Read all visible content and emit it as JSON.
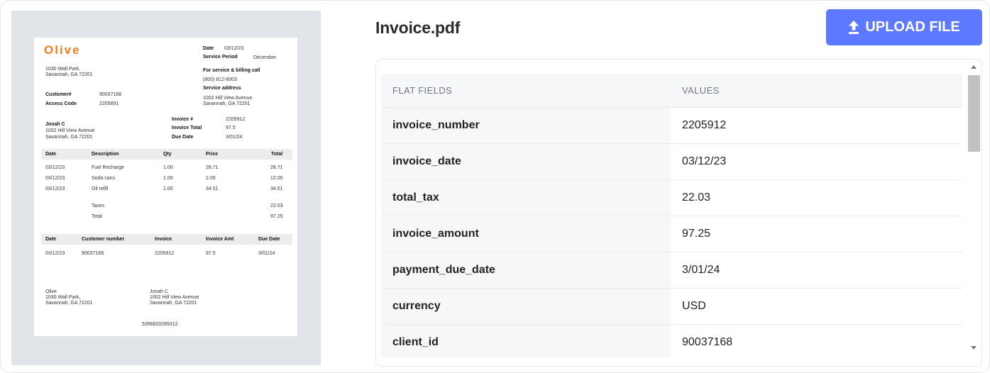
{
  "file": {
    "name": "Invoice.pdf"
  },
  "upload_button": {
    "label": "UPLOAD FILE",
    "icon": "upload-arrow-icon"
  },
  "colors": {
    "accent": "#5c79ff",
    "logo": "#ee7d1d"
  },
  "table": {
    "headers": [
      "FLAT FIELDS",
      "VALUES"
    ],
    "rows": [
      {
        "field": "invoice_number",
        "value": "2205912"
      },
      {
        "field": "invoice_date",
        "value": "03/12/23"
      },
      {
        "field": "total_tax",
        "value": "22.03"
      },
      {
        "field": "invoice_amount",
        "value": "97.25"
      },
      {
        "field": "payment_due_date",
        "value": "3/01/24"
      },
      {
        "field": "currency",
        "value": "USD"
      },
      {
        "field": "client_id",
        "value": "90037168"
      }
    ]
  },
  "doc": {
    "logo": "Olive",
    "sender_address": [
      "1030 Wall Park,",
      "Savannah, GA 72201"
    ],
    "date_label": "Date",
    "date_value": "03/12/23",
    "service_period_label": "Service Period",
    "service_period_value": "December",
    "billing_label": "For service & billing call",
    "billing_phone": "(800) 812-8003",
    "service_address_label": "Service address",
    "service_address": [
      "1002 Hill View Avenue",
      "Savannah, GA 72201"
    ],
    "customer_label": "Customer#",
    "customer_value": "90037168",
    "access_label": "Access Code",
    "access_value": "2205891",
    "invoice_no_label": "Invoice #",
    "invoice_no_value": "2205912",
    "invoice_total_label": "Invoice Total",
    "invoice_total_value": "97.5",
    "due_date_label": "Due Date",
    "due_date_value": "3/01/24",
    "client_name": "Jonah C",
    "client_address": [
      "1002 Hill View Avenue",
      "Savannah, GA 72201"
    ],
    "items_headers": [
      "Date",
      "Description",
      "Qty",
      "Price",
      "Total"
    ],
    "items": [
      {
        "date": "03/12/23",
        "description": "Fuel Recharge",
        "qty": "1.00",
        "price": "28.71",
        "total": "28.71"
      },
      {
        "date": "03/12/23",
        "description": "Soda cans",
        "qty": "1.00",
        "price": "2.00",
        "total": "12.00"
      },
      {
        "date": "03/12/23",
        "description": "Oil refill",
        "qty": "1.00",
        "price": "34.51",
        "total": "34.51"
      }
    ],
    "taxes_label": "Taxes",
    "taxes_value": "22.03",
    "total_label": "Total",
    "total_value": "97.25",
    "summary_headers": [
      "Date",
      "Customer number",
      "Invoice",
      "Invoice Amt",
      "Due Date"
    ],
    "summary_row": [
      "03/12/23",
      "90037168",
      "2205912",
      "97.5",
      "3/01/24"
    ],
    "footer_left": [
      "Olive",
      "1030 Wall Park,",
      "Savannah, GA 72201"
    ],
    "footer_right": [
      "Jonah C",
      "1002 Hill View Avenue",
      "Savannah, GA 72201"
    ],
    "barcode_number": "5356820289312"
  }
}
